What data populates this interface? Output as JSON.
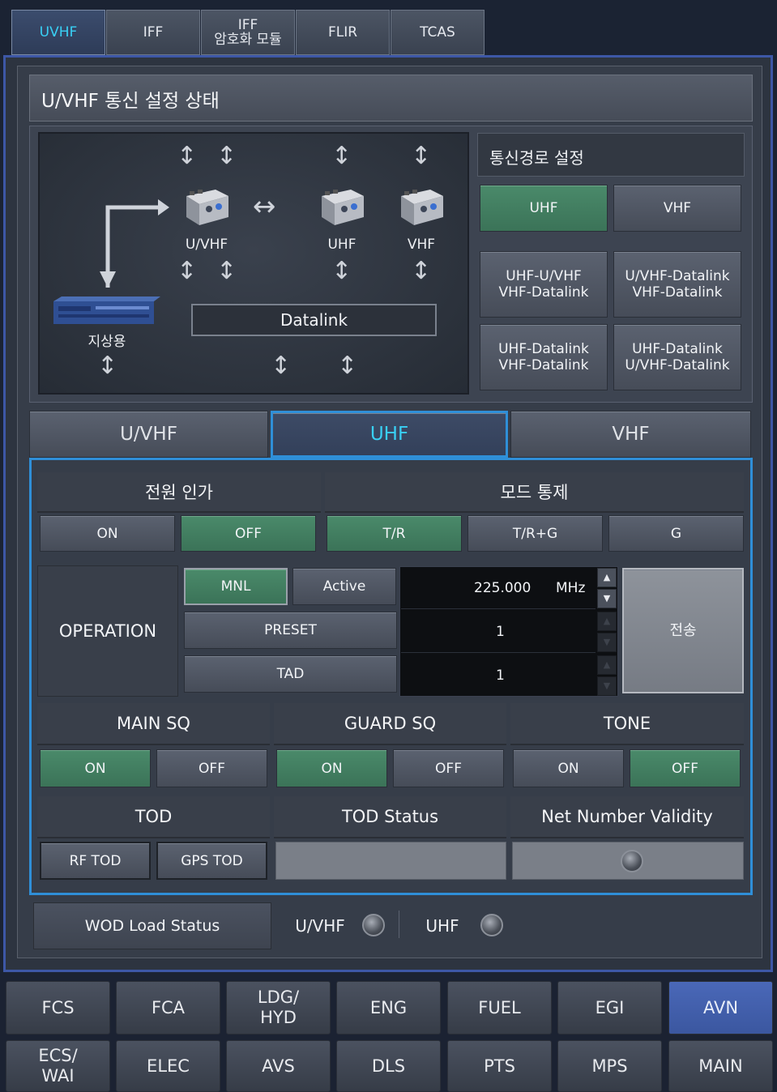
{
  "top_tabs": [
    {
      "label": "UVHF"
    },
    {
      "label": "IFF"
    },
    {
      "label_l1": "IFF",
      "label_l2": "암호화 모듈"
    },
    {
      "label": "FLIR"
    },
    {
      "label": "TCAS"
    }
  ],
  "title": "U/VHF 통신 설정 상태",
  "diagram": {
    "uvhf": "U/VHF",
    "uhf": "UHF",
    "vhf": "VHF",
    "ground": "지상용",
    "datalink": "Datalink"
  },
  "route": {
    "title": "통신경로 설정",
    "uhf": "UHF",
    "vhf": "VHF",
    "opt1_l1": "UHF-U/VHF",
    "opt1_l2": "VHF-Datalink",
    "opt2_l1": "U/VHF-Datalink",
    "opt2_l2": "VHF-Datalink",
    "opt3_l1": "UHF-Datalink",
    "opt3_l2": "VHF-Datalink",
    "opt4_l1": "UHF-Datalink",
    "opt4_l2": "U/VHF-Datalink"
  },
  "radio_tabs": [
    "U/VHF",
    "UHF",
    "VHF"
  ],
  "power": {
    "header": "전원 인가",
    "on": "ON",
    "off": "OFF"
  },
  "mode": {
    "header": "모드 통제",
    "tr": "T/R",
    "trg": "T/R+G",
    "g": "G"
  },
  "operation": {
    "label": "OPERATION",
    "mnl": "MNL",
    "active": "Active",
    "preset": "PRESET",
    "tad": "TAD",
    "freq": "225.000",
    "unit": "MHz",
    "preset_val": "1",
    "tad_val": "1",
    "send": "전송"
  },
  "main_sq": {
    "header": "MAIN SQ",
    "on": "ON",
    "off": "OFF"
  },
  "guard_sq": {
    "header": "GUARD SQ",
    "on": "ON",
    "off": "OFF"
  },
  "tone": {
    "header": "TONE",
    "on": "ON",
    "off": "OFF"
  },
  "tod": {
    "header": "TOD",
    "rf": "RF TOD",
    "gps": "GPS TOD"
  },
  "tod_status": {
    "header": "TOD Status"
  },
  "net_validity": {
    "header": "Net Number Validity"
  },
  "wod": {
    "label": "WOD Load Status",
    "uvhf": "U/VHF",
    "uhf": "UHF"
  },
  "bottom_row1": [
    "FCS",
    "FCA",
    "LDG/\nHYD",
    "ENG",
    "FUEL",
    "EGI",
    "AVN"
  ],
  "bottom_row2": [
    "ECS/\nWAI",
    "ELEC",
    "AVS",
    "DLS",
    "PTS",
    "MPS",
    "MAIN"
  ],
  "colors": {
    "accent": "#39d0f5",
    "green": "#3b7358",
    "frame": "#3d57a6"
  }
}
